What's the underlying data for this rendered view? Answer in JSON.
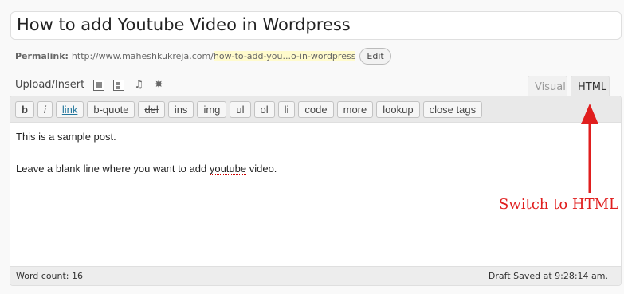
{
  "title_field": {
    "value": "How to add Youtube Video in Wordpress"
  },
  "permalink": {
    "label": "Permalink:",
    "base": "http://www.maheshkukreja.com/",
    "slug": "how-to-add-you...o-in-wordpress",
    "edit_label": "Edit"
  },
  "media": {
    "upload_label": "Upload/Insert",
    "icons": [
      "add-image-icon",
      "add-video-icon",
      "add-audio-icon",
      "add-media-icon"
    ]
  },
  "tabs": {
    "visual": "Visual",
    "html": "HTML"
  },
  "quicktags": [
    "b",
    "i",
    "link",
    "b-quote",
    "del",
    "ins",
    "img",
    "ul",
    "ol",
    "li",
    "code",
    "more",
    "lookup",
    "close tags"
  ],
  "content": {
    "line1": "This is a sample post.",
    "line2_before": "Leave a blank line where you want to add ",
    "line2_link": "youtube",
    "line2_after": " video."
  },
  "status": {
    "word_count": "Word count: 16",
    "draft_saved": "Draft Saved at 9:28:14 am."
  },
  "annotation": {
    "text": "Switch to HTML",
    "color": "#e01e1e"
  }
}
